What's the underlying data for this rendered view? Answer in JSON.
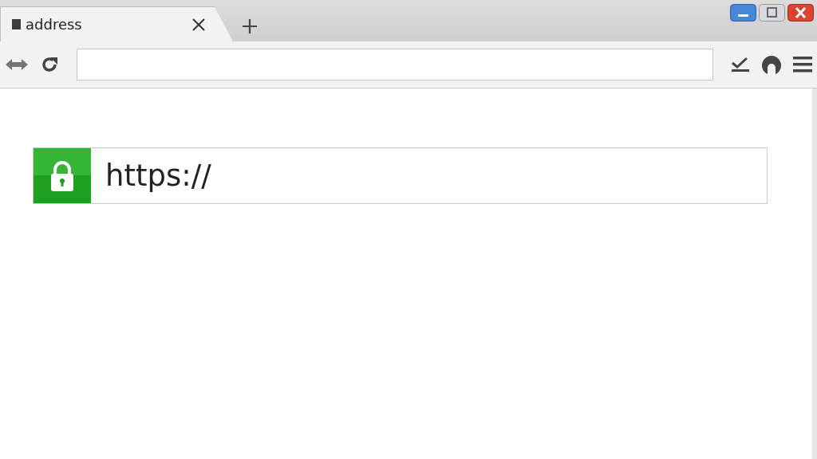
{
  "tabs": [
    {
      "title": "address",
      "selected": true
    }
  ],
  "page": {
    "url_text": "https://",
    "secure": true
  }
}
